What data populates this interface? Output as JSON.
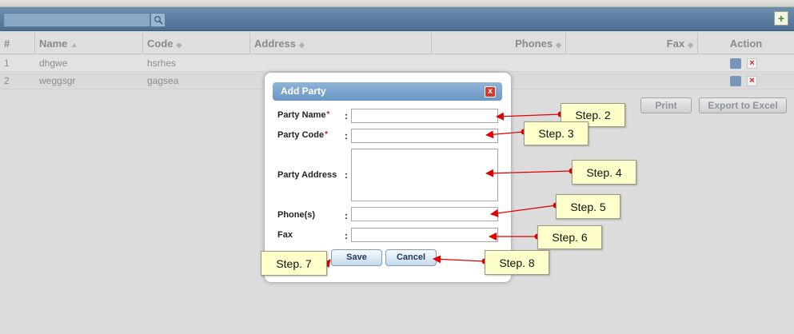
{
  "grid": {
    "columns": [
      {
        "label": "#",
        "sort": ""
      },
      {
        "label": "Name",
        "sort": "▲"
      },
      {
        "label": "Code",
        "sort": "◆"
      },
      {
        "label": "Address",
        "sort": "◆"
      },
      {
        "label": "Phones",
        "sort": "◆"
      },
      {
        "label": "Fax",
        "sort": "◆"
      },
      {
        "label": "Action",
        "sort": ""
      }
    ],
    "rows": [
      {
        "num": "1",
        "name": "dhgwe",
        "code": "hsrhes"
      },
      {
        "num": "2",
        "name": "weggsgr",
        "code": "gagsea"
      }
    ],
    "print_label": "Print",
    "export_label": "Export to Excel"
  },
  "modal": {
    "title": "Add Party",
    "close_label": "x",
    "fields": {
      "party_name": {
        "label": "Party Name",
        "value": ""
      },
      "party_code": {
        "label": "Party Code",
        "value": ""
      },
      "party_address": {
        "label": "Party Address",
        "value": ""
      },
      "phones": {
        "label": "Phone(s)",
        "value": ""
      },
      "fax": {
        "label": "Fax",
        "value": ""
      }
    },
    "required_mark": "*",
    "colon": ":",
    "save_label": "Save",
    "cancel_label": "Cancel"
  },
  "steps": {
    "step2": "Step. 2",
    "step3": "Step. 3",
    "step4": "Step. 4",
    "step5": "Step. 5",
    "step6": "Step. 6",
    "step7": "Step. 7",
    "step8": "Step. 8"
  },
  "colors": {
    "toolbar": "#5a7da1",
    "modal_header": "#7ba6d0",
    "callout_bg": "#ffffcc",
    "arrow": "#e00000"
  }
}
